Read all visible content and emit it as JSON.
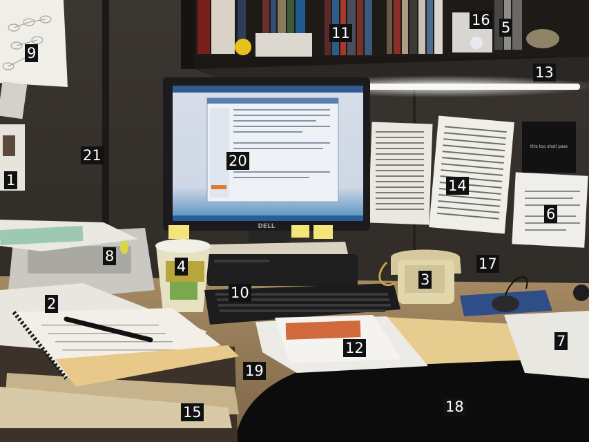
{
  "labels": [
    "1",
    "2",
    "3",
    "4",
    "5",
    "6",
    "7",
    "8",
    "9",
    "10",
    "11",
    "12",
    "13",
    "14",
    "15",
    "16",
    "17",
    "18",
    "19",
    "20",
    "21"
  ],
  "sticker_text": "this too shall pass",
  "monitor_brand": "DELL"
}
